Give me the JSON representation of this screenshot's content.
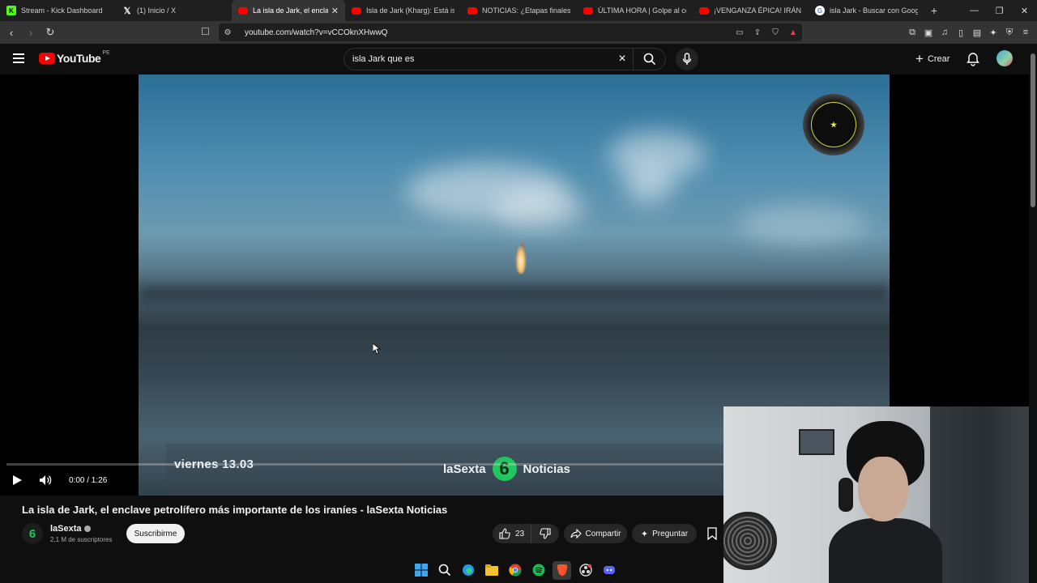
{
  "browser": {
    "tabs": [
      {
        "label": "Stream - Kick Dashboard",
        "icon": "kick-icon"
      },
      {
        "label": "(1) Inicio / X",
        "icon": "x-icon"
      },
      {
        "label": "La isla de Jark, el encla",
        "icon": "youtube-icon",
        "active": true
      },
      {
        "label": "Isla de Jark (Kharg): Está islita",
        "icon": "youtube-icon"
      },
      {
        "label": "NOTICIAS: ¿Etapas finales de la",
        "icon": "youtube-icon"
      },
      {
        "label": "ÚLTIMA HORA | Golpe al coraz",
        "icon": "youtube-icon"
      },
      {
        "label": "¡VENGANZA ÉPICA! IRÁN Aniq",
        "icon": "youtube-icon"
      },
      {
        "label": "isla Jark - Buscar con Google",
        "icon": "google-icon"
      }
    ],
    "url": "youtube.com/watch?v=vCCOknXHwwQ"
  },
  "youtube": {
    "logo_text": "YouTube",
    "country_code": "PE",
    "search_query": "isla Jark que es",
    "create_label": "Crear"
  },
  "video": {
    "watermark_date": "viernes 13.03",
    "watermark_brand_left": "laSexta",
    "watermark_brand_digit": "6",
    "watermark_brand_right": "Noticias",
    "time_display": "0:00 / 1:26",
    "progress": 0.0
  },
  "info": {
    "title": "La isla de Jark, el enclave petrolífero más importante de los iraníes - laSexta Noticias",
    "channel_name": "laSexta",
    "channel_logo_text": "6",
    "subscribers": "2,1 M de suscriptores",
    "subscribe_label": "Suscribirme",
    "likes": "23",
    "share_label": "Compartir",
    "ask_label": "Preguntar"
  },
  "colors": {
    "youtube_red": "#ff0000",
    "lasexta_green": "#22c55e",
    "background": "#0f0f0f"
  }
}
